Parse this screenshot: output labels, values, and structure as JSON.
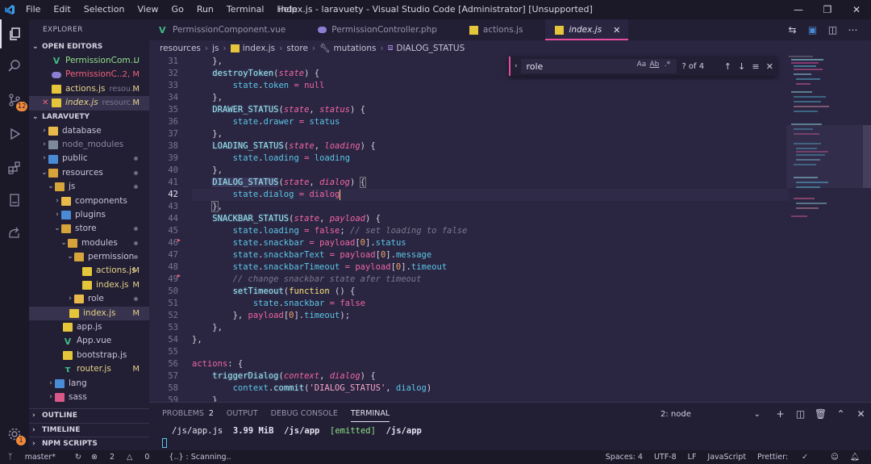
{
  "titlebar": {
    "menu": [
      "File",
      "Edit",
      "Selection",
      "View",
      "Go",
      "Run",
      "Terminal",
      "Help"
    ],
    "title": "index.js - laravuety - Visual Studio Code [Administrator] [Unsupported]"
  },
  "activity": {
    "scm_badge": "12",
    "accounts_badge": "1"
  },
  "sidebar": {
    "title": "EXPLORER",
    "open_editors": {
      "label": "OPEN EDITORS",
      "items": [
        {
          "name": "PermissionCom...",
          "status": "U",
          "color": "#8fe28a"
        },
        {
          "name": "PermissionC...",
          "status": "2, M",
          "color": "#f0637a"
        },
        {
          "name": "actions.js",
          "dir": "resou...",
          "status": "M",
          "color": "#e5d38a"
        },
        {
          "name": "index.js",
          "dir": "resourc...",
          "status": "M",
          "color": "#e5d38a"
        }
      ]
    },
    "project": {
      "label": "LARAVUETY",
      "items": [
        {
          "name": "database"
        },
        {
          "name": "node_modules"
        },
        {
          "name": "public"
        },
        {
          "name": "resources"
        },
        {
          "name": "js"
        },
        {
          "name": "components"
        },
        {
          "name": "plugins"
        },
        {
          "name": "store"
        },
        {
          "name": "modules"
        },
        {
          "name": "permission"
        },
        {
          "name": "actions.js",
          "status": "M"
        },
        {
          "name": "index.js",
          "status": "M"
        },
        {
          "name": "role"
        },
        {
          "name": "index.js",
          "status": "M"
        },
        {
          "name": "app.js"
        },
        {
          "name": "App.vue"
        },
        {
          "name": "bootstrap.js"
        },
        {
          "name": "router.js",
          "status": "M"
        },
        {
          "name": "lang"
        },
        {
          "name": "sass"
        }
      ]
    },
    "outline": "OUTLINE",
    "timeline": "TIMELINE",
    "npm": "NPM SCRIPTS"
  },
  "tabs": [
    {
      "label": "PermissionComponent.vue"
    },
    {
      "label": "PermissionController.php"
    },
    {
      "label": "actions.js"
    },
    {
      "label": "index.js"
    }
  ],
  "breadcrumb": [
    "resources",
    "js",
    "index.js",
    "store",
    "mutations",
    "DIALOG_STATUS"
  ],
  "find": {
    "query": "role",
    "count": "? of 4",
    "opt_case": "Aa",
    "opt_word": "Ab",
    "opt_regex": ".*"
  },
  "editor": {
    "lines": [
      31,
      32,
      33,
      34,
      35,
      36,
      37,
      38,
      39,
      40,
      41,
      42,
      43,
      44,
      45,
      46,
      47,
      48,
      49,
      50,
      51,
      52,
      53,
      54,
      55,
      56,
      57,
      58,
      59
    ]
  },
  "panel": {
    "tabs": [
      {
        "label": "PROBLEMS",
        "count": "2"
      },
      {
        "label": "OUTPUT"
      },
      {
        "label": "DEBUG CONSOLE"
      },
      {
        "label": "TERMINAL"
      }
    ],
    "terminal_select": "2: node",
    "terminal": {
      "path1": "/js/app.js",
      "size": "3.99 MiB",
      "path2": "/js/app",
      "emitted": "[emitted]",
      "path3": "/js/app"
    }
  },
  "status": {
    "branch": "master*",
    "errors": "2",
    "warnings": "0",
    "scanning": "{..} : Scanning..",
    "spaces": "Spaces: 4",
    "encoding": "UTF-8",
    "eol": "LF",
    "language": "JavaScript",
    "prettier": "Prettier:"
  }
}
